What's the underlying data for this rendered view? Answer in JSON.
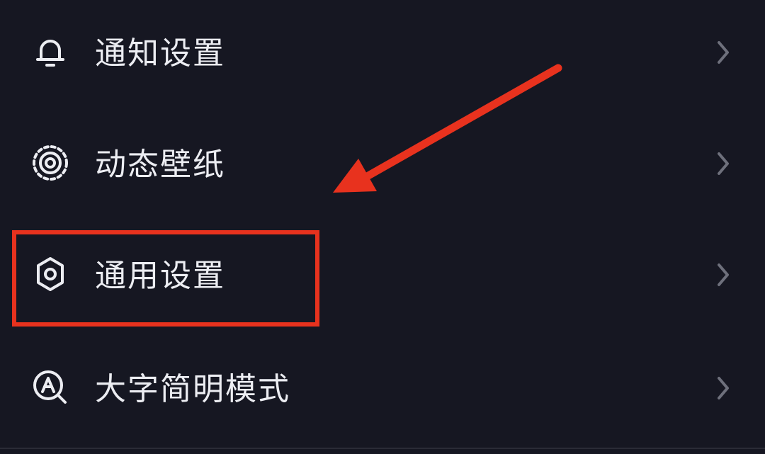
{
  "menu": {
    "items": [
      {
        "id": "notifications",
        "label": "通知设置",
        "icon": "bell-icon"
      },
      {
        "id": "live-wallpaper",
        "label": "动态壁纸",
        "icon": "wallpaper-ring-icon"
      },
      {
        "id": "general",
        "label": "通用设置",
        "icon": "gear-icon"
      },
      {
        "id": "large-font",
        "label": "大字简明模式",
        "icon": "font-magnifier-icon"
      }
    ]
  },
  "annotation": {
    "highlight_target": "general",
    "highlight_color": "#E8321E",
    "arrow_color": "#E8321E"
  },
  "colors": {
    "background": "#161722",
    "text": "#ECEDF2",
    "chevron": "#6E707C"
  }
}
